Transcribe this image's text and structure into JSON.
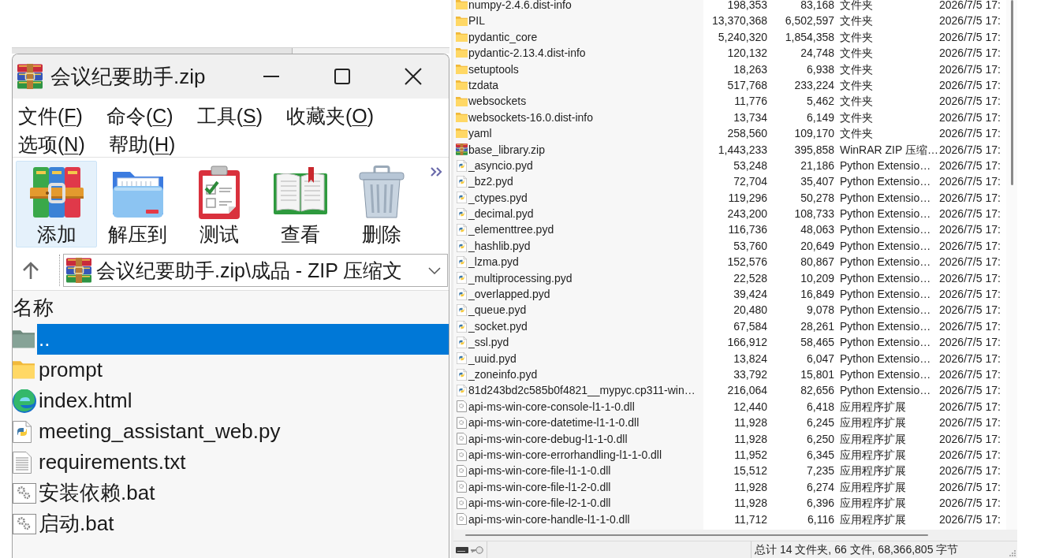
{
  "archive_window": {
    "title": "会议纪要助手.zip",
    "menu": [
      {
        "prefix": "文件(",
        "underlined": "F",
        "suffix": ")"
      },
      {
        "prefix": "命令(",
        "underlined": "C",
        "suffix": ")"
      },
      {
        "prefix": "工具(",
        "underlined": "S",
        "suffix": ")"
      },
      {
        "prefix": "收藏夹(",
        "underlined": "O",
        "suffix": ")"
      },
      {
        "prefix": "选项(",
        "underlined": "N",
        "suffix": ")"
      },
      {
        "prefix": "帮助(",
        "underlined": "H",
        "suffix": ")"
      }
    ],
    "toolbar": [
      {
        "kind": "add",
        "label": "添加",
        "selected": true
      },
      {
        "kind": "extract",
        "label": "解压到",
        "selected": false
      },
      {
        "kind": "test",
        "label": "测试",
        "selected": false
      },
      {
        "kind": "view",
        "label": "查看",
        "selected": false
      },
      {
        "kind": "delete",
        "label": "删除",
        "selected": false
      }
    ],
    "address": {
      "path": "会议纪要助手.zip\\成品 - ZIP 压缩文"
    },
    "list": {
      "column": "名称",
      "items": [
        {
          "kind": "parent",
          "name": "..",
          "selected": true
        },
        {
          "kind": "folder",
          "name": "prompt",
          "selected": false
        },
        {
          "kind": "html",
          "name": "index.html",
          "selected": false
        },
        {
          "kind": "python",
          "name": "meeting_assistant_web.py",
          "selected": false
        },
        {
          "kind": "text",
          "name": "requirements.txt",
          "selected": false
        },
        {
          "kind": "batch",
          "name": "安装依赖.bat",
          "selected": false
        },
        {
          "kind": "batch",
          "name": "启动.bat",
          "selected": false
        }
      ]
    }
  },
  "file_list": {
    "rows": [
      {
        "kind": "folder",
        "name": "numpy-2.4.6.dist-info",
        "size": "198,353",
        "packed": "83,168",
        "type": "文件夹",
        "modified": "2026/7/5 17:"
      },
      {
        "kind": "folder",
        "name": "PIL",
        "size": "13,370,368",
        "packed": "6,502,597",
        "type": "文件夹",
        "modified": "2026/7/5 17:"
      },
      {
        "kind": "folder",
        "name": "pydantic_core",
        "size": "5,240,320",
        "packed": "1,854,358",
        "type": "文件夹",
        "modified": "2026/7/5 17:"
      },
      {
        "kind": "folder",
        "name": "pydantic-2.13.4.dist-info",
        "size": "120,132",
        "packed": "24,748",
        "type": "文件夹",
        "modified": "2026/7/5 17:"
      },
      {
        "kind": "folder",
        "name": "setuptools",
        "size": "18,263",
        "packed": "6,938",
        "type": "文件夹",
        "modified": "2026/7/5 17:"
      },
      {
        "kind": "folder",
        "name": "tzdata",
        "size": "517,768",
        "packed": "233,224",
        "type": "文件夹",
        "modified": "2026/7/5 17:"
      },
      {
        "kind": "folder",
        "name": "websockets",
        "size": "11,776",
        "packed": "5,462",
        "type": "文件夹",
        "modified": "2026/7/5 17:"
      },
      {
        "kind": "folder",
        "name": "websockets-16.0.dist-info",
        "size": "13,734",
        "packed": "6,149",
        "type": "文件夹",
        "modified": "2026/7/5 17:"
      },
      {
        "kind": "folder",
        "name": "yaml",
        "size": "258,560",
        "packed": "109,170",
        "type": "文件夹",
        "modified": "2026/7/5 17:"
      },
      {
        "kind": "zip",
        "name": "base_library.zip",
        "size": "1,443,233",
        "packed": "395,858",
        "type": "WinRAR ZIP 压缩…",
        "modified": "2026/7/5 17:"
      },
      {
        "kind": "pyd",
        "name": "_asyncio.pyd",
        "size": "53,248",
        "packed": "21,186",
        "type": "Python Extensio…",
        "modified": "2026/7/5 17:"
      },
      {
        "kind": "pyd",
        "name": "_bz2.pyd",
        "size": "72,704",
        "packed": "35,407",
        "type": "Python Extensio…",
        "modified": "2026/7/5 17:"
      },
      {
        "kind": "pyd",
        "name": "_ctypes.pyd",
        "size": "119,296",
        "packed": "50,278",
        "type": "Python Extensio…",
        "modified": "2026/7/5 17:"
      },
      {
        "kind": "pyd",
        "name": "_decimal.pyd",
        "size": "243,200",
        "packed": "108,733",
        "type": "Python Extensio…",
        "modified": "2026/7/5 17:"
      },
      {
        "kind": "pyd",
        "name": "_elementtree.pyd",
        "size": "116,736",
        "packed": "48,063",
        "type": "Python Extensio…",
        "modified": "2026/7/5 17:"
      },
      {
        "kind": "pyd",
        "name": "_hashlib.pyd",
        "size": "53,760",
        "packed": "20,649",
        "type": "Python Extensio…",
        "modified": "2026/7/5 17:"
      },
      {
        "kind": "pyd",
        "name": "_lzma.pyd",
        "size": "152,576",
        "packed": "80,867",
        "type": "Python Extensio…",
        "modified": "2026/7/5 17:"
      },
      {
        "kind": "pyd",
        "name": "_multiprocessing.pyd",
        "size": "22,528",
        "packed": "10,209",
        "type": "Python Extensio…",
        "modified": "2026/7/5 17:"
      },
      {
        "kind": "pyd",
        "name": "_overlapped.pyd",
        "size": "39,424",
        "packed": "16,849",
        "type": "Python Extensio…",
        "modified": "2026/7/5 17:"
      },
      {
        "kind": "pyd",
        "name": "_queue.pyd",
        "size": "20,480",
        "packed": "9,078",
        "type": "Python Extensio…",
        "modified": "2026/7/5 17:"
      },
      {
        "kind": "pyd",
        "name": "_socket.pyd",
        "size": "67,584",
        "packed": "28,261",
        "type": "Python Extensio…",
        "modified": "2026/7/5 17:"
      },
      {
        "kind": "pyd",
        "name": "_ssl.pyd",
        "size": "166,912",
        "packed": "58,465",
        "type": "Python Extensio…",
        "modified": "2026/7/5 17:"
      },
      {
        "kind": "pyd",
        "name": "_uuid.pyd",
        "size": "13,824",
        "packed": "6,047",
        "type": "Python Extensio…",
        "modified": "2026/7/5 17:"
      },
      {
        "kind": "pyd",
        "name": "_zoneinfo.pyd",
        "size": "33,792",
        "packed": "15,801",
        "type": "Python Extensio…",
        "modified": "2026/7/5 17:"
      },
      {
        "kind": "pyd",
        "name": "81d243bd2c585b0f4821__mypyc.cp311-win…",
        "size": "216,064",
        "packed": "82,656",
        "type": "Python Extensio…",
        "modified": "2026/7/5 17:"
      },
      {
        "kind": "dll",
        "name": "api-ms-win-core-console-l1-1-0.dll",
        "size": "12,440",
        "packed": "6,418",
        "type": "应用程序扩展",
        "modified": "2026/7/5 17:"
      },
      {
        "kind": "dll",
        "name": "api-ms-win-core-datetime-l1-1-0.dll",
        "size": "11,928",
        "packed": "6,245",
        "type": "应用程序扩展",
        "modified": "2026/7/5 17:"
      },
      {
        "kind": "dll",
        "name": "api-ms-win-core-debug-l1-1-0.dll",
        "size": "11,928",
        "packed": "6,250",
        "type": "应用程序扩展",
        "modified": "2026/7/5 17:"
      },
      {
        "kind": "dll",
        "name": "api-ms-win-core-errorhandling-l1-1-0.dll",
        "size": "11,952",
        "packed": "6,345",
        "type": "应用程序扩展",
        "modified": "2026/7/5 17:"
      },
      {
        "kind": "dll",
        "name": "api-ms-win-core-file-l1-1-0.dll",
        "size": "15,512",
        "packed": "7,235",
        "type": "应用程序扩展",
        "modified": "2026/7/5 17:"
      },
      {
        "kind": "dll",
        "name": "api-ms-win-core-file-l1-2-0.dll",
        "size": "11,928",
        "packed": "6,274",
        "type": "应用程序扩展",
        "modified": "2026/7/5 17:"
      },
      {
        "kind": "dll",
        "name": "api-ms-win-core-file-l2-1-0.dll",
        "size": "11,928",
        "packed": "6,396",
        "type": "应用程序扩展",
        "modified": "2026/7/5 17:"
      },
      {
        "kind": "dll",
        "name": "api-ms-win-core-handle-l1-1-0.dll",
        "size": "11,712",
        "packed": "6,116",
        "type": "应用程序扩展",
        "modified": "2026/7/5 17:"
      }
    ]
  },
  "status_bar": {
    "text": "总计 14 文件夹, 66 文件, 68,366,805 字节"
  }
}
